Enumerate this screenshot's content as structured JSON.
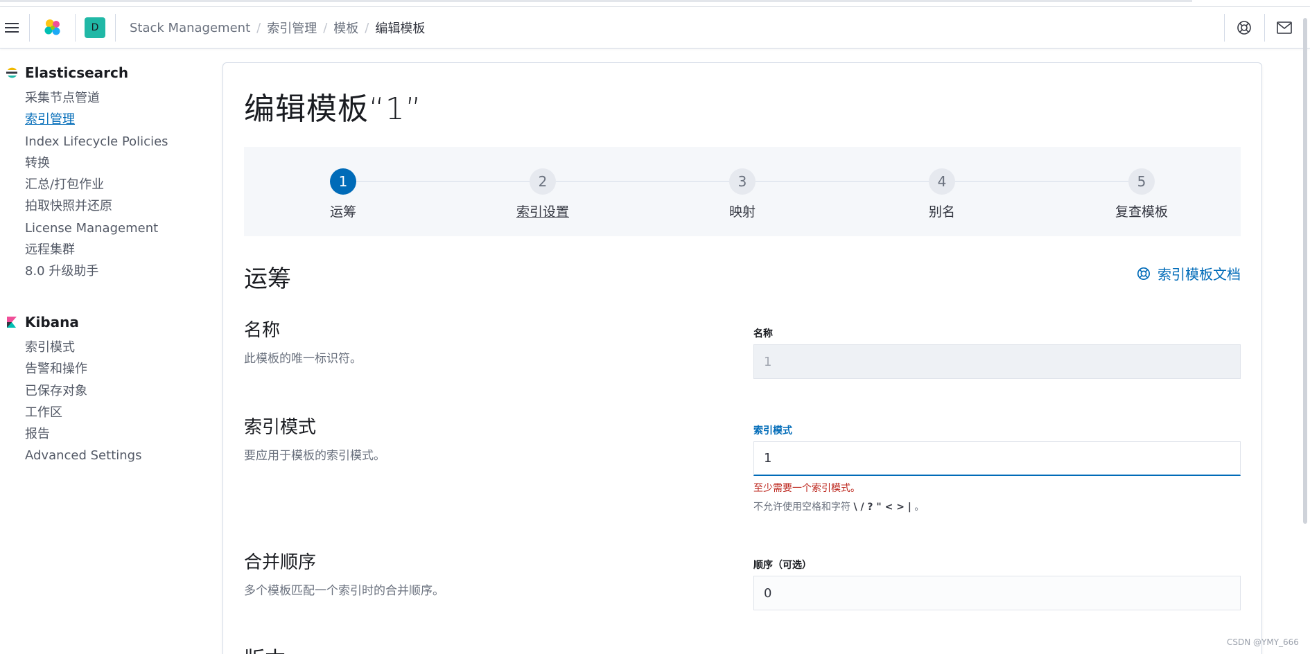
{
  "header": {
    "space_initial": "D",
    "breadcrumbs": [
      "Stack Management",
      "索引管理",
      "模板",
      "编辑模板"
    ]
  },
  "sidebar": {
    "elasticsearch": {
      "title": "Elasticsearch",
      "items": [
        {
          "label": "采集节点管道"
        },
        {
          "label": "索引管理",
          "active": true
        },
        {
          "label": "Index Lifecycle Policies"
        },
        {
          "label": "转换"
        },
        {
          "label": "汇总/打包作业"
        },
        {
          "label": "拍取快照并还原"
        },
        {
          "label": "License Management"
        },
        {
          "label": "远程集群"
        },
        {
          "label": "8.0 升级助手"
        }
      ]
    },
    "kibana": {
      "title": "Kibana",
      "items": [
        {
          "label": "索引模式"
        },
        {
          "label": "告警和操作"
        },
        {
          "label": "已保存对象"
        },
        {
          "label": "工作区"
        },
        {
          "label": "报告"
        },
        {
          "label": "Advanced Settings"
        }
      ]
    }
  },
  "main": {
    "page_title": "编辑模板“1”",
    "steps": [
      {
        "number": "1",
        "label": "运筹",
        "current": true
      },
      {
        "number": "2",
        "label": "索引设置"
      },
      {
        "number": "3",
        "label": "映射"
      },
      {
        "number": "4",
        "label": "别名"
      },
      {
        "number": "5",
        "label": "复查模板"
      }
    ],
    "section_title": "运筹",
    "doc_link": "索引模板文档",
    "name_row": {
      "title": "名称",
      "description": "此模板的唯一标识符。",
      "field_label": "名称",
      "value": "1"
    },
    "pattern_row": {
      "title": "索引模式",
      "description": "要应用于模板的索引模式。",
      "field_label": "索引模式",
      "value": "1",
      "error": "至少需要一个索引模式。",
      "help_prefix": "不允许使用空格和字符",
      "help_chars": "\\ / ? \" < > |",
      "help_suffix": "。"
    },
    "order_row": {
      "title": "合并顺序",
      "description": "多个模板匹配一个索引时的合并顺序。",
      "field_label": "顺序（可选）",
      "value": "0"
    },
    "next_title_partial": "版本"
  },
  "watermark": "CSDN @YMY_666",
  "colors": {
    "accent": "#006bb8",
    "error": "#bd271e",
    "space_badge": "#20b8a6"
  }
}
